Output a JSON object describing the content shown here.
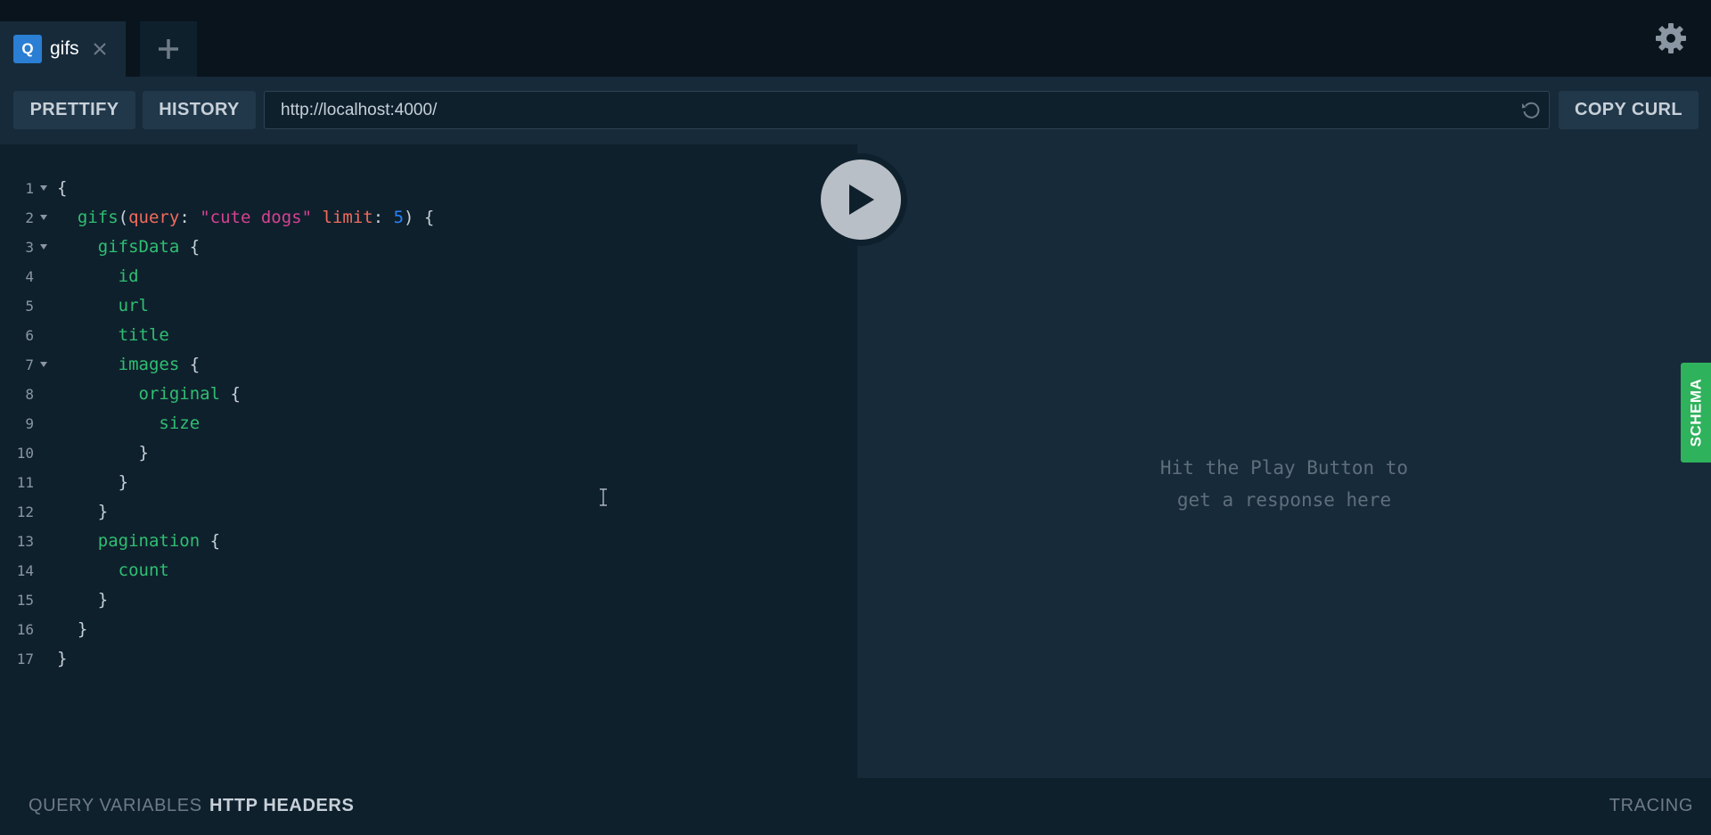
{
  "tabs": [
    {
      "badge": "Q",
      "label": "gifs"
    }
  ],
  "toolbar": {
    "prettify_label": "PRETTIFY",
    "history_label": "HISTORY",
    "endpoint_url": "http://localhost:4000/",
    "copy_curl_label": "COPY CURL"
  },
  "editor": {
    "lines": [
      {
        "n": "1",
        "fold": true,
        "tokens": [
          {
            "t": "punct",
            "v": "{"
          }
        ]
      },
      {
        "n": "2",
        "fold": true,
        "tokens": [
          {
            "t": "ws",
            "v": "  "
          },
          {
            "t": "field",
            "v": "gifs"
          },
          {
            "t": "punct",
            "v": "("
          },
          {
            "t": "arg",
            "v": "query"
          },
          {
            "t": "punct",
            "v": ": "
          },
          {
            "t": "str",
            "v": "\"cute dogs\""
          },
          {
            "t": "ws",
            "v": " "
          },
          {
            "t": "arg",
            "v": "limit"
          },
          {
            "t": "punct",
            "v": ": "
          },
          {
            "t": "num",
            "v": "5"
          },
          {
            "t": "punct",
            "v": ") {"
          }
        ]
      },
      {
        "n": "3",
        "fold": true,
        "tokens": [
          {
            "t": "ws",
            "v": "    "
          },
          {
            "t": "field",
            "v": "gifsData"
          },
          {
            "t": "punct",
            "v": " {"
          }
        ]
      },
      {
        "n": "4",
        "fold": false,
        "tokens": [
          {
            "t": "ws",
            "v": "      "
          },
          {
            "t": "field",
            "v": "id"
          }
        ]
      },
      {
        "n": "5",
        "fold": false,
        "tokens": [
          {
            "t": "ws",
            "v": "      "
          },
          {
            "t": "field",
            "v": "url"
          }
        ]
      },
      {
        "n": "6",
        "fold": false,
        "tokens": [
          {
            "t": "ws",
            "v": "      "
          },
          {
            "t": "field",
            "v": "title"
          }
        ]
      },
      {
        "n": "7",
        "fold": true,
        "tokens": [
          {
            "t": "ws",
            "v": "      "
          },
          {
            "t": "field",
            "v": "images"
          },
          {
            "t": "punct",
            "v": " {"
          }
        ]
      },
      {
        "n": "8",
        "fold": false,
        "tokens": [
          {
            "t": "ws",
            "v": "        "
          },
          {
            "t": "field",
            "v": "original"
          },
          {
            "t": "punct",
            "v": " {"
          }
        ]
      },
      {
        "n": "9",
        "fold": false,
        "tokens": [
          {
            "t": "ws",
            "v": "          "
          },
          {
            "t": "field",
            "v": "size"
          }
        ]
      },
      {
        "n": "10",
        "fold": false,
        "tokens": [
          {
            "t": "ws",
            "v": "        "
          },
          {
            "t": "punct",
            "v": "}"
          }
        ]
      },
      {
        "n": "11",
        "fold": false,
        "tokens": [
          {
            "t": "ws",
            "v": "      "
          },
          {
            "t": "punct",
            "v": "}"
          }
        ]
      },
      {
        "n": "12",
        "fold": false,
        "tokens": [
          {
            "t": "ws",
            "v": "    "
          },
          {
            "t": "punct",
            "v": "}"
          }
        ]
      },
      {
        "n": "13",
        "fold": false,
        "tokens": [
          {
            "t": "ws",
            "v": "    "
          },
          {
            "t": "field",
            "v": "pagination"
          },
          {
            "t": "punct",
            "v": " {"
          }
        ]
      },
      {
        "n": "14",
        "fold": false,
        "tokens": [
          {
            "t": "ws",
            "v": "      "
          },
          {
            "t": "field",
            "v": "count"
          }
        ]
      },
      {
        "n": "15",
        "fold": false,
        "tokens": [
          {
            "t": "ws",
            "v": "    "
          },
          {
            "t": "punct",
            "v": "}"
          }
        ]
      },
      {
        "n": "16",
        "fold": false,
        "tokens": [
          {
            "t": "ws",
            "v": "  "
          },
          {
            "t": "punct",
            "v": "}"
          }
        ]
      },
      {
        "n": "17",
        "fold": false,
        "tokens": [
          {
            "t": "punct",
            "v": "}"
          }
        ]
      }
    ]
  },
  "result": {
    "placeholder_line1": "Hit the Play Button to",
    "placeholder_line2": "get a response here",
    "schema_label": "SCHEMA"
  },
  "bottom": {
    "query_variables_label": "QUERY VARIABLES",
    "http_headers_label": "HTTP HEADERS",
    "tracing_label": "TRACING"
  },
  "icons": {
    "tab_close": "close-icon",
    "new_tab": "plus-icon",
    "settings": "gear-icon",
    "reload": "reload-icon",
    "play": "play-icon"
  },
  "colors": {
    "background": "#172a3a",
    "editor_background": "#0f202d",
    "tab_badge": "#2a7ed3",
    "schema_tab": "#2fb25c",
    "field": "#2fbf71",
    "argument": "#f26b5b",
    "string": "#d64292",
    "number": "#2882f9"
  }
}
